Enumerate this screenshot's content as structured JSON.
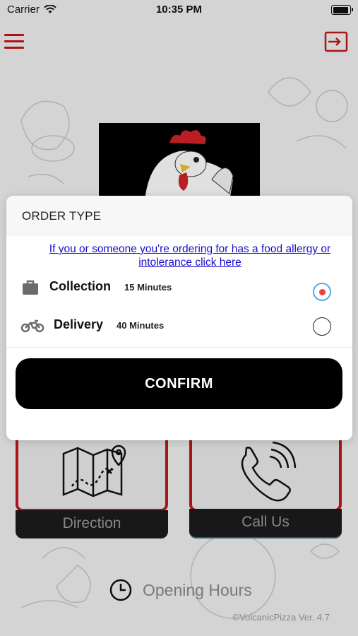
{
  "status_bar": {
    "carrier": "Carrier",
    "time": "10:35 PM",
    "wifi_icon": "wifi-icon",
    "battery_icon": "battery-icon"
  },
  "header": {
    "menu_icon": "hamburger-menu-icon",
    "login_icon": "sign-in-icon",
    "accent_color": "#c4161c"
  },
  "logo": {
    "icon": "rooster-logo"
  },
  "tiles": {
    "direction": {
      "label": "Direction",
      "icon": "map-pin-icon"
    },
    "call": {
      "label": "Call Us",
      "icon": "phone-ringing-icon"
    }
  },
  "opening_hours": {
    "label": "Opening Hours",
    "icon": "clock-icon"
  },
  "version": "©VolcanicPizza Ver. 4.7",
  "modal": {
    "title": "ORDER TYPE",
    "allergy_link": "If you or someone you're ordering for has a food allergy or intolerance click here",
    "options": [
      {
        "label": "Collection",
        "time": "15 Minutes",
        "icon": "briefcase-icon",
        "selected": true
      },
      {
        "label": "Delivery",
        "time": "40 Minutes",
        "icon": "motorbike-icon",
        "selected": false
      }
    ],
    "confirm_label": "CONFIRM",
    "selected_color": "#e8453c",
    "radio_ring_color": "#5aa9e6"
  }
}
